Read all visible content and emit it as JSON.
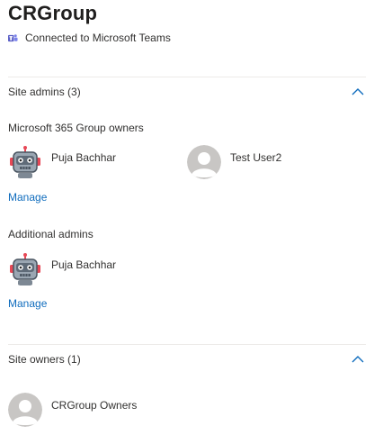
{
  "site": {
    "title": "CRGroup",
    "connection_text": "Connected to Microsoft Teams"
  },
  "site_admins": {
    "header": "Site admins (3)",
    "group_owners_label": "Microsoft 365 Group owners",
    "group_owners": [
      {
        "name": "Puja Bachhar",
        "avatar": "robot-avatar"
      },
      {
        "name": "Test User2",
        "avatar": "default-person-avatar"
      }
    ],
    "manage_label_1": "Manage",
    "additional_admins_label": "Additional admins",
    "additional_admins": [
      {
        "name": "Puja Bachhar",
        "avatar": "robot-avatar"
      }
    ],
    "manage_label_2": "Manage"
  },
  "site_owners": {
    "header": "Site owners (1)",
    "owners": [
      {
        "name": "CRGroup Owners",
        "avatar": "default-person-avatar"
      }
    ]
  },
  "colors": {
    "accent_link": "#0f6cbd",
    "chevron": "#0f6cbd",
    "divider": "#edebe9",
    "avatar_gray": "#c8c6c4"
  }
}
